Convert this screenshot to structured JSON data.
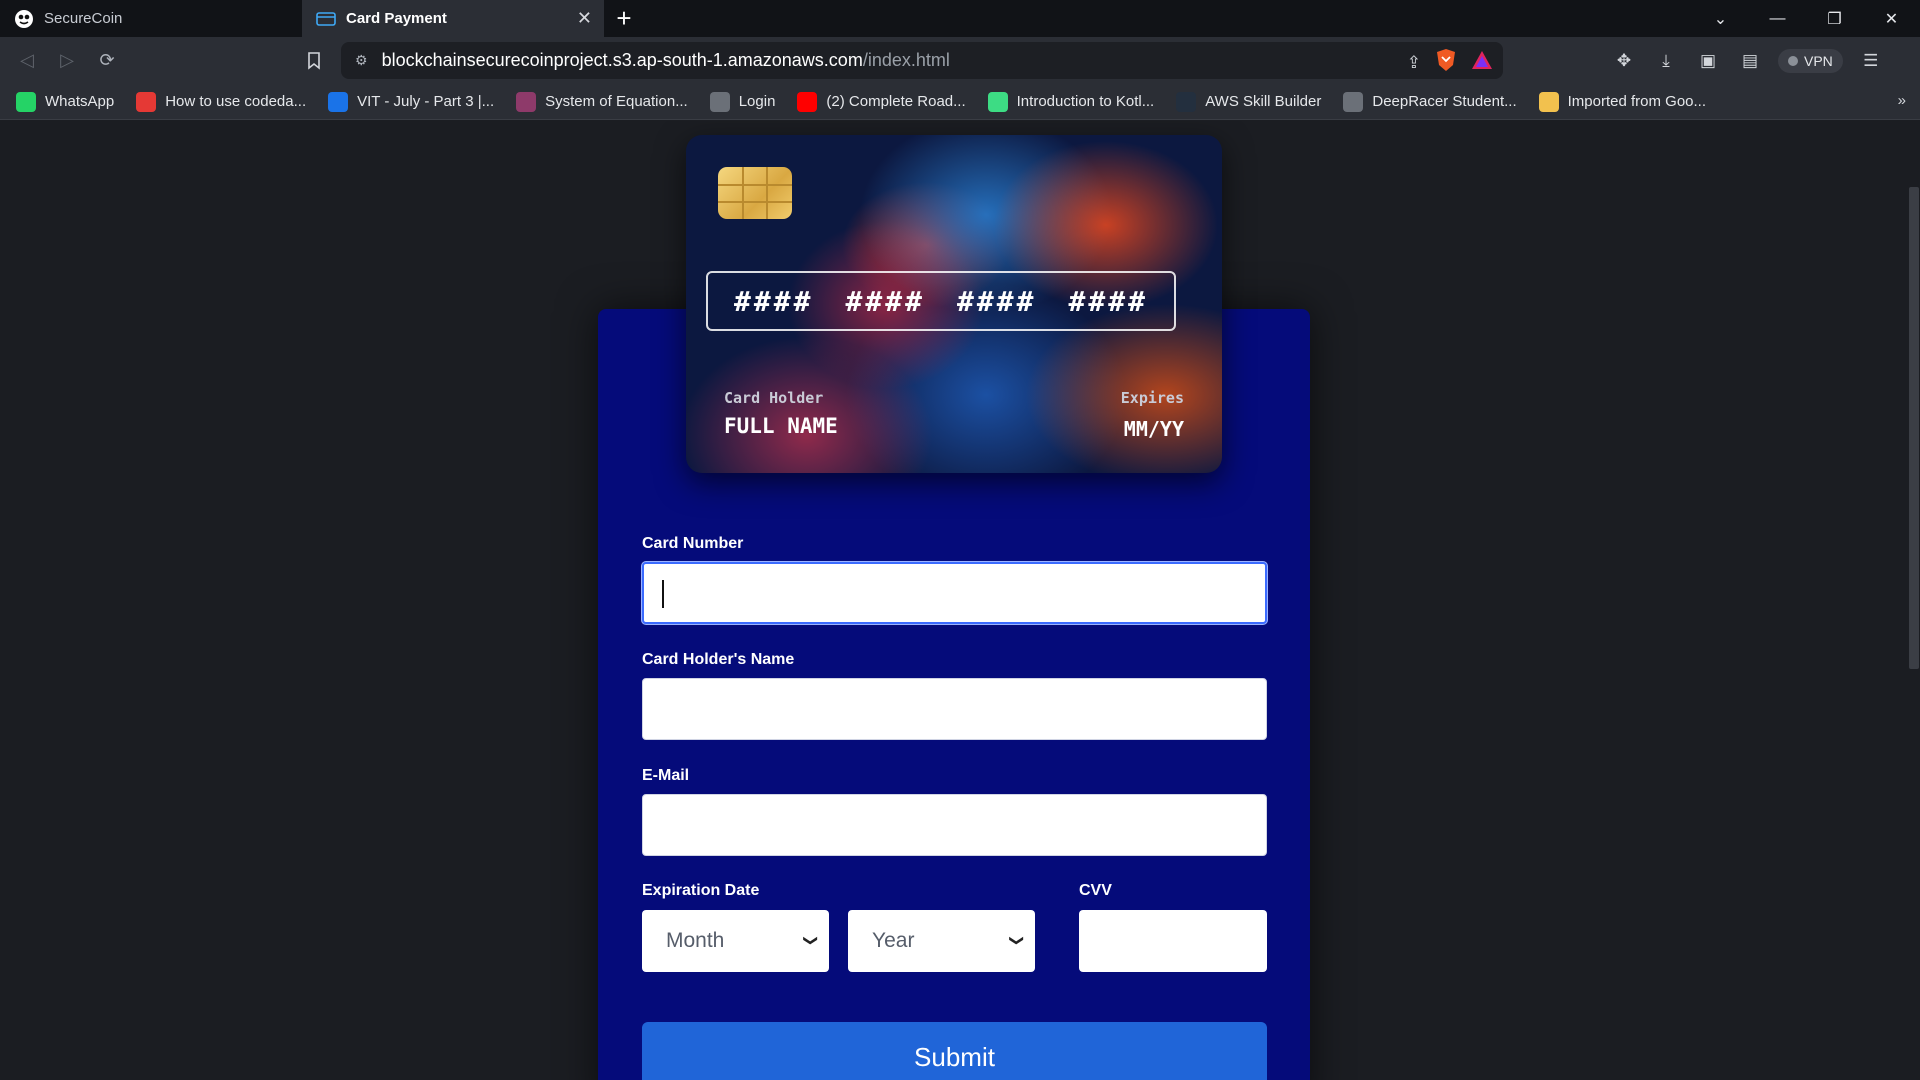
{
  "browser": {
    "tabs": [
      {
        "label": "SecureCoin",
        "active": false
      },
      {
        "label": "Card Payment",
        "active": true
      }
    ],
    "new_tab": "+",
    "url_main": "blockchainsecurecoinproject.s3.ap-south-1.amazonaws.com",
    "url_path": "/index.html",
    "vpn_label": "VPN",
    "bookmarks": [
      {
        "label": "WhatsApp",
        "icon": "whatsapp-icon",
        "color": "#25d366"
      },
      {
        "label": "How to use codeda...",
        "icon": "codedamn-icon",
        "color": "#e53935"
      },
      {
        "label": "VIT - July - Part 3 |...",
        "icon": "coursera-icon",
        "color": "#1a73e8"
      },
      {
        "label": "System of Equation...",
        "icon": "page-icon",
        "color": "#8e3a6a"
      },
      {
        "label": "Login",
        "icon": "globe-icon",
        "color": "#6b7078"
      },
      {
        "label": "(2) Complete Road...",
        "icon": "youtube-icon",
        "color": "#ff0000"
      },
      {
        "label": "Introduction to Kotl...",
        "icon": "android-icon",
        "color": "#3ddc84"
      },
      {
        "label": "AWS Skill Builder",
        "icon": "aws-icon",
        "color": "#232f3e"
      },
      {
        "label": "DeepRacer Student...",
        "icon": "deepracer-icon",
        "color": "#6b7078"
      },
      {
        "label": "Imported from Goo...",
        "icon": "folder-icon",
        "color": "#f2c14e"
      }
    ],
    "bookmarks_more": "»"
  },
  "card": {
    "number_groups": [
      "####",
      "####",
      "####",
      "####"
    ],
    "holder_label": "Card Holder",
    "holder_value": "FULL NAME",
    "expires_label": "Expires",
    "expires_value": "MM/YY"
  },
  "form": {
    "card_number_label": "Card Number",
    "card_number_value": "",
    "holder_name_label": "Card Holder's Name",
    "email_label": "E-Mail",
    "expiration_label": "Expiration Date",
    "month_value": "Month",
    "year_value": "Year",
    "cvv_label": "CVV",
    "submit_label": "Submit"
  }
}
